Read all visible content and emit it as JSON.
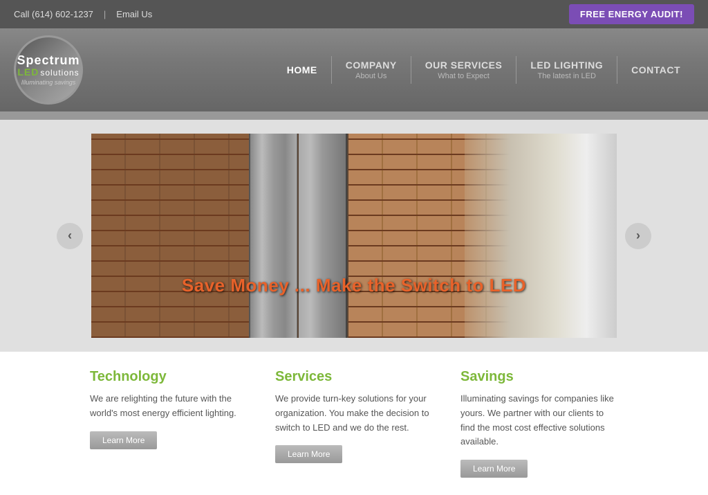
{
  "topbar": {
    "phone": "Call (614) 602-1237",
    "divider": "|",
    "email_label": "Email Us",
    "audit_btn": "FREE ENERGY AUDIT!"
  },
  "logo": {
    "spectrum": "Spectrum",
    "led": "LED",
    "solutions": "solutions",
    "tagline": "Illuminating savings"
  },
  "nav": [
    {
      "id": "home",
      "main": "HOME",
      "sub": ""
    },
    {
      "id": "company",
      "main": "COMPANY",
      "sub": "About Us"
    },
    {
      "id": "our-services",
      "main": "OUR SERVICES",
      "sub": "What to Expect"
    },
    {
      "id": "led-lighting",
      "main": "LED LIGHTING",
      "sub": "The latest in LED"
    },
    {
      "id": "contact",
      "main": "CONTACT",
      "sub": ""
    }
  ],
  "hero": {
    "text": "Save Money ... Make the Switch to LED",
    "prev_label": "‹",
    "next_label": "›"
  },
  "features": [
    {
      "id": "technology",
      "title": "Technology",
      "text": "We are relighting the future with the world's most energy efficient lighting.",
      "btn": "Learn More"
    },
    {
      "id": "services",
      "title": "Services",
      "text": "We provide turn-key solutions for your organization. You make the decision to switch to LED and we do the rest.",
      "btn": "Learn More"
    },
    {
      "id": "savings",
      "title": "Savings",
      "text": "Illuminating savings for companies like yours. We partner with our clients to find the most cost effective solutions available.",
      "btn": "Learn More"
    }
  ],
  "colors": {
    "green": "#7db83a",
    "purple": "#7b4db5",
    "orange": "#e8622a",
    "nav_bg": "#6e6e6e"
  }
}
